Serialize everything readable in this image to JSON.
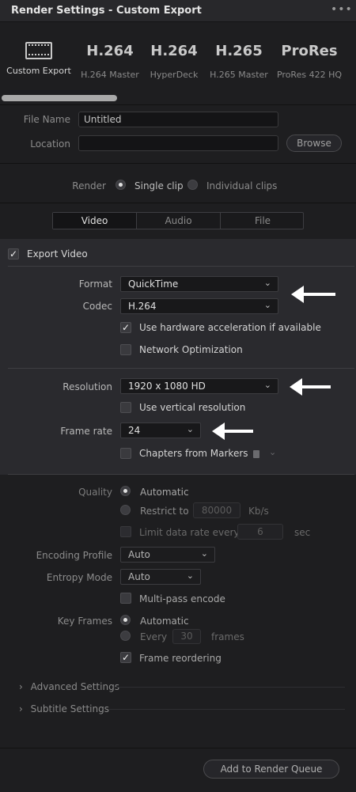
{
  "header": {
    "title": "Render Settings - Custom Export",
    "menu": "•••"
  },
  "presets": [
    {
      "big": "",
      "label": "Custom Export",
      "icon": "film-icon",
      "active": true
    },
    {
      "big": "H.264",
      "label": "H.264 Master"
    },
    {
      "big": "H.264",
      "label": "HyperDeck"
    },
    {
      "big": "H.265",
      "label": "H.265 Master"
    },
    {
      "big": "ProRes",
      "label": "ProRes 422 HQ"
    }
  ],
  "file": {
    "name_label": "File Name",
    "name_value": "Untitled",
    "location_label": "Location",
    "location_value": "",
    "browse": "Browse"
  },
  "render": {
    "label": "Render",
    "single": "Single clip",
    "individual": "Individual clips",
    "selected": "single"
  },
  "tabs": [
    "Video",
    "Audio",
    "File"
  ],
  "video": {
    "export_label": "Export Video",
    "format_label": "Format",
    "format_value": "QuickTime",
    "codec_label": "Codec",
    "codec_value": "H.264",
    "hw_accel": "Use hardware acceleration if available",
    "network_opt": "Network Optimization",
    "resolution_label": "Resolution",
    "resolution_value": "1920 x 1080 HD",
    "vertical_res": "Use vertical resolution",
    "framerate_label": "Frame rate",
    "framerate_value": "24",
    "chapters": "Chapters from Markers"
  },
  "quality": {
    "label": "Quality",
    "automatic": "Automatic",
    "restrict": "Restrict to",
    "restrict_value": "80000",
    "restrict_unit": "Kb/s",
    "limit": "Limit data rate every",
    "limit_value": "6",
    "limit_unit": "sec"
  },
  "encoding": {
    "profile_label": "Encoding Profile",
    "profile_value": "Auto",
    "entropy_label": "Entropy Mode",
    "entropy_value": "Auto",
    "multipass": "Multi-pass encode"
  },
  "keyframes": {
    "label": "Key Frames",
    "automatic": "Automatic",
    "every": "Every",
    "every_value": "30",
    "every_unit": "frames",
    "reordering": "Frame reordering"
  },
  "sections": {
    "advanced": "Advanced Settings",
    "subtitle": "Subtitle Settings"
  },
  "footer": {
    "add": "Add to Render Queue"
  },
  "colors": {
    "panel": "#2a2a2e",
    "bg": "#1e1e20",
    "arrow": "#ffffff"
  }
}
